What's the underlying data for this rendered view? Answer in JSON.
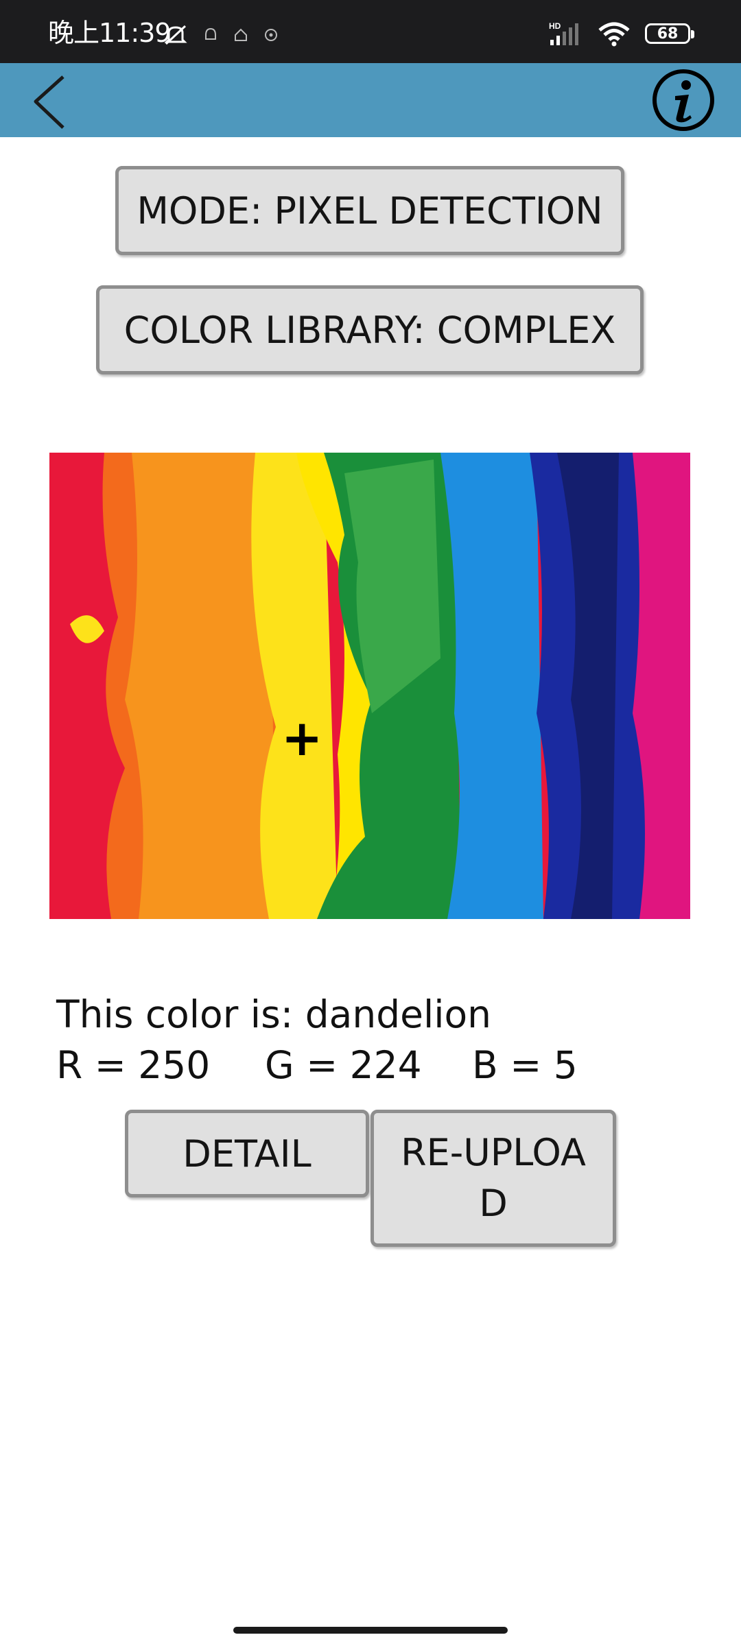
{
  "status_bar": {
    "time": "晚上11:39",
    "battery": "68",
    "network": "HD"
  },
  "app_bar": {
    "back_icon": "chevron-left-icon",
    "info_icon": "info-circle-icon",
    "color": "#4e98bd"
  },
  "controls": {
    "mode_label": "MODE: PIXEL DETECTION",
    "library_label": "COLOR LIBRARY: COMPLEX"
  },
  "result": {
    "color_text": "This color is: dandelion",
    "r_text": "R = 250",
    "g_text": "G = 224",
    "b_text": "B = 5"
  },
  "actions": {
    "detail_label": "DETAIL",
    "reupload_label": "RE-UPLOAD"
  }
}
